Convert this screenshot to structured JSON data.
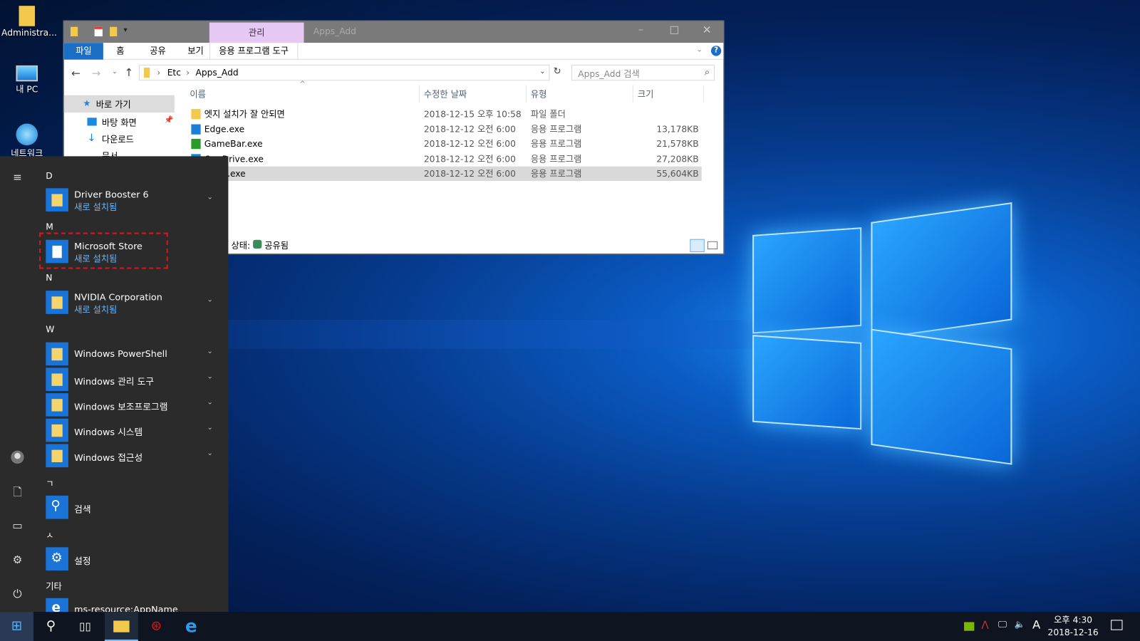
{
  "desktop": {
    "icons": [
      {
        "label": "Administra...",
        "icon": "user-folder-icon"
      },
      {
        "label": "내 PC",
        "icon": "computer-icon"
      },
      {
        "label": "네트워크",
        "icon": "network-icon"
      }
    ]
  },
  "explorer": {
    "contextual_tab": "관리",
    "title": "Apps_Add",
    "ribbon_tabs": [
      "파일",
      "홈",
      "공유",
      "보기",
      "응용 프로그램 도구"
    ],
    "breadcrumb": [
      "Etc",
      "Apps_Add"
    ],
    "search_placeholder": "Apps_Add 검색",
    "nav": [
      "바로 가기",
      "바탕 화면",
      "다운로드",
      "문서"
    ],
    "columns": [
      "이름",
      "수정한 날짜",
      "유형",
      "크기"
    ],
    "files": [
      {
        "name": "엣지 설치가 잘 안되면",
        "date": "2018-12-15 오후 10:58",
        "type": "파일 폴더",
        "size": "",
        "icon": "folder-icon"
      },
      {
        "name": "Edge.exe",
        "date": "2018-12-12 오전 6:00",
        "type": "응용 프로그램",
        "size": "13,178KB",
        "icon": "edge-icon"
      },
      {
        "name": "GameBar.exe",
        "date": "2018-12-12 오전 6:00",
        "type": "응용 프로그램",
        "size": "21,578KB",
        "icon": "xbox-icon"
      },
      {
        "name": "OneDrive.exe",
        "date": "2018-12-12 오전 6:00",
        "type": "응용 프로그램",
        "size": "27,208KB",
        "icon": "onedrive-icon"
      },
      {
        "name": "Store.exe",
        "date": "2018-12-12 오전 6:00",
        "type": "응용 프로그램",
        "size": "55,604KB",
        "icon": "store-icon",
        "selected": true
      }
    ],
    "status_label": "상태:",
    "status_value": "공유됨"
  },
  "start_menu": {
    "groups": [
      {
        "letter": "D",
        "apps": [
          {
            "name": "Driver Booster 6",
            "sub": "새로 설치됨",
            "expand": true
          }
        ]
      },
      {
        "letter": "M",
        "apps": [
          {
            "name": "Microsoft Store",
            "sub": "새로 설치됨",
            "highlighted": true
          }
        ]
      },
      {
        "letter": "N",
        "apps": [
          {
            "name": "NVIDIA Corporation",
            "sub": "새로 설치됨",
            "expand": true
          }
        ]
      },
      {
        "letter": "W",
        "apps": [
          {
            "name": "Windows PowerShell",
            "expand": true
          },
          {
            "name": "Windows 관리 도구",
            "expand": true
          },
          {
            "name": "Windows 보조프로그램",
            "expand": true
          },
          {
            "name": "Windows 시스템",
            "expand": true
          },
          {
            "name": "Windows 접근성",
            "expand": true
          }
        ]
      },
      {
        "letter": "ㄱ",
        "apps": [
          {
            "name": "검색"
          }
        ]
      },
      {
        "letter": "ㅅ",
        "apps": [
          {
            "name": "설정"
          }
        ]
      },
      {
        "letter": "기타",
        "apps": [
          {
            "name": "ms-resource:AppName"
          }
        ]
      }
    ],
    "highlight_color": "#e0141e"
  },
  "taskbar": {
    "ime": "A",
    "time": "오후 4:30",
    "date": "2018-12-16"
  }
}
